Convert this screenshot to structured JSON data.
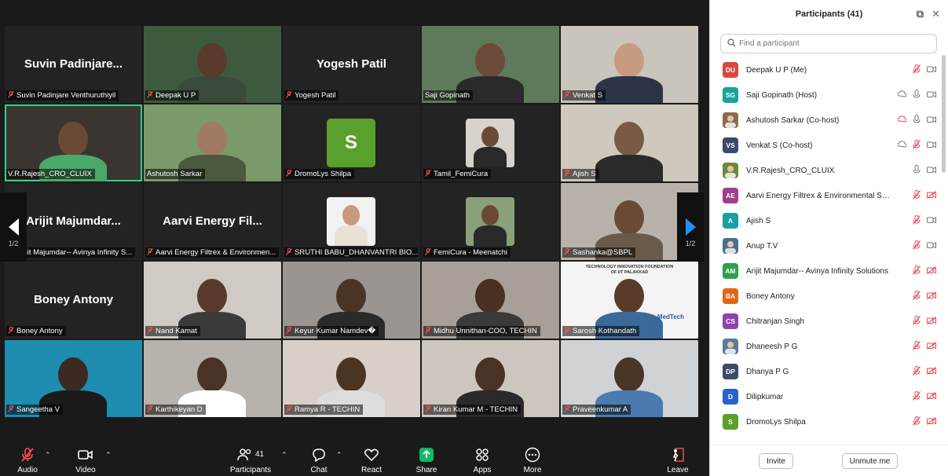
{
  "tiles": [
    {
      "label": "Suvin Padinjare Venthuruthiyil",
      "big": "Suvin Padinjare...",
      "muted": true
    },
    {
      "label": "Deepak U P",
      "muted": true
    },
    {
      "label": "Yogesh Patil",
      "big": "Yogesh Patil",
      "muted": true
    },
    {
      "label": "Saji Gopinath",
      "muted": false
    },
    {
      "label": "Venkat S",
      "muted": true
    },
    {
      "label": "V.R.Rajesh_CRO_CLUIX",
      "muted": false
    },
    {
      "label": "Ashutosh Sarkar",
      "muted": false
    },
    {
      "label": "DromoLys Shilpa",
      "avatar": "S",
      "muted": true
    },
    {
      "label": "Tamil_FemiCura",
      "muted": true
    },
    {
      "label": "Ajish S",
      "muted": true
    },
    {
      "label": "Arijit Majumdar-- Avinya Infinity S...",
      "big": "Arijit Majumdar...",
      "muted": true
    },
    {
      "label": "Aarvi Energy Filtrex & Environmen...",
      "big": "Aarvi Energy Fil...",
      "muted": true
    },
    {
      "label": "SRUTHI BABU_DHANVANTRI BIO...",
      "muted": true
    },
    {
      "label": "FemiCura - Meenatchi",
      "muted": true
    },
    {
      "label": "Sashanka@SBPL",
      "muted": true
    },
    {
      "label": "Boney Antony",
      "big": "Boney Antony",
      "muted": true
    },
    {
      "label": "Nand Kamat",
      "muted": true
    },
    {
      "label": "Keyur Kumar Namdev�",
      "muted": true
    },
    {
      "label": "Midhu Unnithan-COO, TECHIN",
      "muted": true
    },
    {
      "label": "Sarosh Kothandath",
      "muted": true
    },
    {
      "label": "Sangeetha V",
      "muted": true
    },
    {
      "label": "Karthikeyan D",
      "muted": true
    },
    {
      "label": "Ramya R - TECHIN",
      "muted": true
    },
    {
      "label": "Kiran Kumar M - TECHIN",
      "muted": true
    },
    {
      "label": "Praveenkumar A",
      "muted": true
    }
  ],
  "slide_text": {
    "line1": "TECHNOLOGY INNOVATION FOUNDATION",
    "line2": "OF IIT PALAKKAD",
    "brand": "MedTech"
  },
  "pager": {
    "left_page": "1/2",
    "right_page": "1/2"
  },
  "toolbar": {
    "audio": "Audio",
    "video": "Video",
    "participants": "Participants",
    "participants_count": "41",
    "chat": "Chat",
    "react": "React",
    "share": "Share",
    "apps": "Apps",
    "more": "More",
    "leave": "Leave"
  },
  "panel": {
    "title": "Participants (41)",
    "search_placeholder": "Find a participant",
    "invite": "Invite",
    "unmute_me": "Unmute me",
    "participants": [
      {
        "initials": "DU",
        "name": "Deepak U P (Me)",
        "color": "#d9483b",
        "rec": false
      },
      {
        "initials": "SG",
        "name": "Saji Gopinath (Host)",
        "color": "#1aa39a",
        "rec": true
      },
      {
        "initials": "",
        "name": "Ashutosh Sarkar (Co-host)",
        "color": "#8a6a4e",
        "rec": true
      },
      {
        "initials": "VS",
        "name": "Venkat S (Co-host)",
        "color": "#3b4a6b",
        "rec": true
      },
      {
        "initials": "",
        "name": "V.R.Rajesh_CRO_CLUIX",
        "color": "#6b8a3a",
        "rec": false
      },
      {
        "initials": "AE",
        "name": "Aarvi Energy Filtrex & Environmental Solutio...",
        "color": "#a13d8f",
        "rec": false
      },
      {
        "initials": "A",
        "name": "Ajish S",
        "color": "#17a0a3",
        "rec": false
      },
      {
        "initials": "",
        "name": "Anup T.V",
        "color": "#4a6f8a",
        "rec": false
      },
      {
        "initials": "AM",
        "name": "Arijit Majumdar-- Avinya Infinity Solutions",
        "color": "#2f9e4f",
        "rec": false
      },
      {
        "initials": "BA",
        "name": "Boney Antony",
        "color": "#e0661a",
        "rec": false
      },
      {
        "initials": "CS",
        "name": "Chitranjan Singh",
        "color": "#8e44ad",
        "rec": false
      },
      {
        "initials": "",
        "name": "Dhaneesh P G",
        "color": "#5b7a99",
        "rec": false
      },
      {
        "initials": "DP",
        "name": "Dhanya P G",
        "color": "#3b4a6b",
        "rec": false
      },
      {
        "initials": "D",
        "name": "Dilipkumar",
        "color": "#2563c9",
        "rec": false
      },
      {
        "initials": "S",
        "name": "DromoLys Shilpa",
        "color": "#5aa02c",
        "rec": false
      }
    ]
  },
  "colors": {
    "accent_green": "#2ed38c",
    "muted_red": "#ff4d4f",
    "share_green": "#12b76a",
    "leave_red": "#e5484d"
  }
}
